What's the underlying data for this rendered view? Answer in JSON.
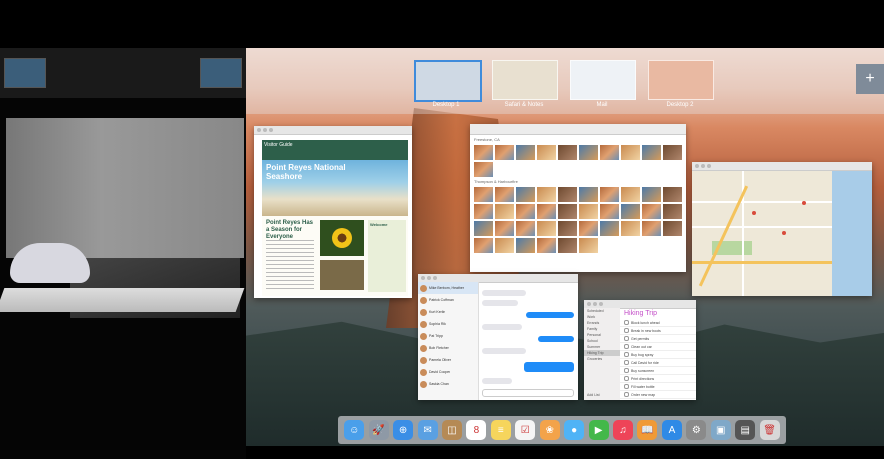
{
  "spaces": [
    {
      "label": "Desktop 1",
      "active": true
    },
    {
      "label": "Safari & Notes",
      "active": false
    },
    {
      "label": "Mail",
      "active": false
    },
    {
      "label": "Desktop 2",
      "active": false
    }
  ],
  "add_space_label": "+",
  "preview": {
    "head_text": "Visitor Guide",
    "hero_title": "Point Reyes National Seashore",
    "subtitle": "Point Reyes Has a Season for Everyone",
    "sidebar_title": "Welcome"
  },
  "photos": {
    "section1": "Freestone, CA",
    "section2": "Thompson & Harbourfire"
  },
  "messages": {
    "contacts": [
      "Mike Berbom, Heather",
      "Patrick Coffman",
      "Kurt Kerlin",
      "Sophia Rik",
      "Pat Tripp",
      "Bob Fletcher",
      "Pamela Oliver",
      "David Cooper",
      "Saskia Chan"
    ]
  },
  "reminders": {
    "lists": [
      "Scheduled",
      "Work",
      "Errands",
      "Family",
      "Personal",
      "School",
      "Summer",
      "Hiking Trip",
      "Groceries"
    ],
    "selected_list": "Hiking Trip",
    "title": "Hiking Trip",
    "items": [
      "Block lunch ahead",
      "Break in new boots",
      "Get permits",
      "Clean out car",
      "Buy bug spray",
      "Call David for ride",
      "Buy sunscreen",
      "Print directions",
      "Fill water bottle",
      "Order new map"
    ],
    "add_list_label": "Add List"
  },
  "dock": [
    {
      "name": "finder-icon",
      "color": "#4a9fea",
      "glyph": "☺"
    },
    {
      "name": "launchpad-icon",
      "color": "#8e99a6",
      "glyph": "🚀"
    },
    {
      "name": "safari-icon",
      "color": "#3a8ee6",
      "glyph": "⊕"
    },
    {
      "name": "mail-icon",
      "color": "#5aa0e2",
      "glyph": "✉"
    },
    {
      "name": "contacts-icon",
      "color": "#b58a55",
      "glyph": "◫"
    },
    {
      "name": "calendar-icon",
      "color": "#ffffff",
      "glyph": "8"
    },
    {
      "name": "notes-icon",
      "color": "#f6d55c",
      "glyph": "≡"
    },
    {
      "name": "reminders-icon",
      "color": "#f5f5f5",
      "glyph": "☑"
    },
    {
      "name": "photos-app-icon",
      "color": "#f3a34a",
      "glyph": "❀"
    },
    {
      "name": "messages-icon",
      "color": "#4fb3f6",
      "glyph": "●"
    },
    {
      "name": "facetime-icon",
      "color": "#43b84a",
      "glyph": "▶"
    },
    {
      "name": "music-icon",
      "color": "#ee4458",
      "glyph": "♫"
    },
    {
      "name": "ibooks-icon",
      "color": "#f09a36",
      "glyph": "📖"
    },
    {
      "name": "app-store-icon",
      "color": "#2f8ae6",
      "glyph": "A"
    },
    {
      "name": "system-preferences-icon",
      "color": "#8a8a8a",
      "glyph": "⚙"
    },
    {
      "name": "preview-icon",
      "color": "#7fa8c8",
      "glyph": "▣"
    },
    {
      "name": "downloads-stack-icon",
      "color": "#555555",
      "glyph": "▤"
    },
    {
      "name": "trash-icon",
      "color": "#d8d8d8",
      "glyph": "🗑"
    }
  ]
}
